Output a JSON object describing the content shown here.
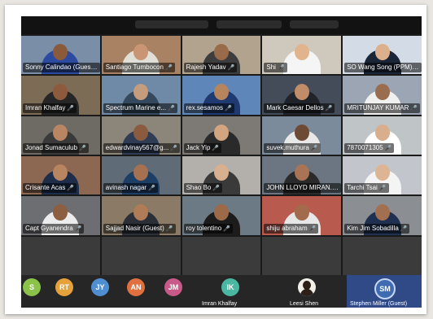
{
  "participants": [
    {
      "name": "Sonny Calindao (Guest)",
      "bg": "#7a8fa7",
      "skin": "#8a5a3b",
      "shirt": "#2b4aa0"
    },
    {
      "name": "Santiago Tumbocon",
      "bg": "#a88262",
      "skin": "#c99574",
      "shirt": "#e0dfd8"
    },
    {
      "name": "Rajesh Yadav",
      "bg": "#b1a38d",
      "skin": "#9a6b4b",
      "shirt": "#3d3d3d"
    },
    {
      "name": "Shi",
      "bg": "#cfc8bc",
      "skin": "#e1b48e",
      "shirt": "#f5f5f5"
    },
    {
      "name": "SO Wang Song (PPM)",
      "bg": "#d3dbe6",
      "skin": "#dcb08c",
      "shirt": "#1b2538"
    },
    {
      "name": "Imran Khalfay",
      "bg": "#7c6b55",
      "skin": "#8d5a3d",
      "shirt": "#262626"
    },
    {
      "name": "Spectrum Marine e...",
      "bg": "#6f8aa6",
      "skin": "#c59c7c",
      "shirt": "#34495e"
    },
    {
      "name": "rex.sesamos",
      "bg": "#5f86b9",
      "skin": "#b6855e",
      "shirt": "#1f3a70"
    },
    {
      "name": "Mark Caesar Dellos",
      "bg": "#434c58",
      "skin": "#c08d68",
      "shirt": "#20242a"
    },
    {
      "name": "MRITUNJAY KUMAR",
      "bg": "#9ba5b3",
      "skin": "#9a6d4e",
      "shirt": "#f0f0f0"
    },
    {
      "name": "Jonad Sumaculub",
      "bg": "#6e6a64",
      "skin": "#b98563",
      "shirt": "#3a3a3a"
    },
    {
      "name": "edwardvinay567@g...",
      "bg": "#8c8579",
      "skin": "#8a5b3e",
      "shirt": "#2f3c55"
    },
    {
      "name": "Jack Yip",
      "bg": "#7d7a75",
      "skin": "#d2a47f",
      "shirt": "#2a2a2a"
    },
    {
      "name": "suvek.muthura",
      "bg": "#7b8b9b",
      "skin": "#6d4a33",
      "shirt": "#e8e8e8"
    },
    {
      "name": "7870071305",
      "bg": "#bfc4c7",
      "skin": "#d9ae8c",
      "shirt": "#ffffff"
    },
    {
      "name": "Crisante Acas",
      "bg": "#8c6752",
      "skin": "#b7855f",
      "shirt": "#1e2d4a"
    },
    {
      "name": "avinash nagar",
      "bg": "#5f6c77",
      "skin": "#a57151",
      "shirt": "#1d3f66"
    },
    {
      "name": "Shao Bo",
      "bg": "#b3b0ab",
      "skin": "#d8b08f",
      "shirt": "#3a3a3a"
    },
    {
      "name": "JOHN LLOYD MIRAN...",
      "bg": "#6b7682",
      "skin": "#a87455",
      "shirt": "#2a2a2a"
    },
    {
      "name": "Tarchi Tsai",
      "bg": "#c2c6cc",
      "skin": "#ddb595",
      "shirt": "#f4f4f4"
    },
    {
      "name": "Capt Gyanendra",
      "bg": "#6d6e72",
      "skin": "#8d5e40",
      "shirt": "#ececec"
    },
    {
      "name": "Sajjad Nasir (Guest)",
      "bg": "#8a7a66",
      "skin": "#b07c58",
      "shirt": "#2a2f38"
    },
    {
      "name": "roy tolentino",
      "bg": "#6b7a84",
      "skin": "#9c6a48",
      "shirt": "#1c1c1c"
    },
    {
      "name": "shiju abraham",
      "bg": "#b85a4e",
      "skin": "#a26b4c",
      "shirt": "#e7e7e7"
    },
    {
      "name": "Kim Jim Sobadilla",
      "bg": "#8b8f94",
      "skin": "#a27050",
      "shirt": "#203050"
    },
    {
      "name": "",
      "bg": "#3b3b3b",
      "skin": "#3b3b3b",
      "shirt": "#3b3b3b"
    },
    {
      "name": "",
      "bg": "#3b3b3b",
      "skin": "#3b3b3b",
      "shirt": "#3b3b3b"
    },
    {
      "name": "",
      "bg": "#3b3b3b",
      "skin": "#3b3b3b",
      "shirt": "#3b3b3b"
    },
    {
      "name": "",
      "bg": "#3b3b3b",
      "skin": "#3b3b3b",
      "shirt": "#3b3b3b"
    },
    {
      "name": "",
      "bg": "#3b3b3b",
      "skin": "#3b3b3b",
      "shirt": "#3b3b3b"
    }
  ],
  "bottom": {
    "initials": {
      "s": "S",
      "rt": "RT",
      "jy": "JY",
      "an": "AN",
      "jm": "JM"
    },
    "imran": {
      "initials": "IK",
      "name": "Imran Khalfay"
    },
    "leesi": {
      "name": "Leesi Shen"
    },
    "stephen": {
      "initials": "SM",
      "name": "Stephen Miller (Guest)"
    }
  }
}
